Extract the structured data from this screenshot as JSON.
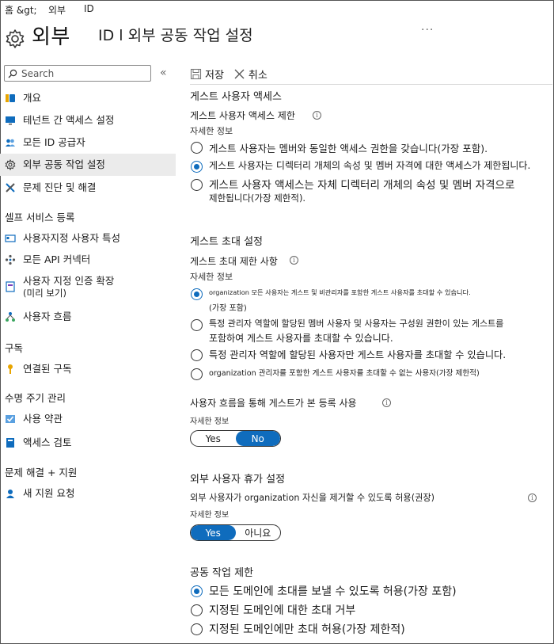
{
  "breadcrumb": [
    "홈 &gt;",
    "외부",
    "ID"
  ],
  "header": {
    "title": "외부",
    "subtitle": "ID l 외부 공동 작업 설정",
    "more": "···"
  },
  "sidebar": {
    "search_placeholder": "Search",
    "collapse": "«",
    "items": [
      {
        "label": "개요",
        "icon": "info-icon"
      },
      {
        "label": "테넌트 간 액세스 설정",
        "icon": "monitor-icon"
      },
      {
        "label": "모든 ID 공급자",
        "icon": "users-icon"
      },
      {
        "label": "외부 공동 작업 설정",
        "icon": "gear-icon"
      },
      {
        "label": "문제 진단 및 해결",
        "icon": "tools-icon"
      }
    ],
    "section_self_service": "셀프 서비스 등록",
    "self_service_items": [
      {
        "label": "사용자지정 사용자 특성",
        "icon": "card-icon"
      },
      {
        "label": "모든 API 커넥터",
        "icon": "connector-icon"
      },
      {
        "label": "사용자 지정 인증 확장",
        "label2": "(미리 보기)",
        "icon": "extension-icon"
      },
      {
        "label": "사용자 흐름",
        "icon": "flow-icon"
      }
    ],
    "section_subscription": "구독",
    "subscription_items": [
      {
        "label": "연결된 구독",
        "icon": "key-icon"
      }
    ],
    "section_lifecycle": "수명 주기 관리",
    "lifecycle_items": [
      {
        "label": "사용 약관",
        "icon": "checklist-icon"
      },
      {
        "label": "액세스 검토",
        "icon": "book-icon"
      }
    ],
    "section_support": "문제 해결 + 지원",
    "support_items": [
      {
        "label": "새 지원 요청",
        "icon": "support-icon"
      }
    ]
  },
  "toolbar": {
    "save": "저장",
    "cancel": "취소"
  },
  "guest_access": {
    "heading": "게스트 사용자 액세스",
    "subheading": "게스트 사용자 액세스 제한",
    "more_info": "자세한 정보",
    "options": [
      "게스트 사용자는 멤버와 동일한 액세스 권한을 갖습니다(가장 포함).",
      "게스트 사용자는 디렉터리 개체의 속성 및 멤버 자격에 대한 액세스가 제한됩니다.",
      "게스트 사용자 액세스는 자체 디렉터리 개체의 속성 및 멤버 자격으로",
      "제한됩니다(가장 제한적)."
    ],
    "selected": 1
  },
  "guest_invite": {
    "heading": "게스트 초대 설정",
    "subheading": "게스트 초대 제한 사항",
    "more_info": "자세한 정보",
    "options": [
      "organization 모든 사용자는 게스트 및 비관리자를 포함한 게스트 사용자를 초대할 수 있습니다.",
      "(가장 포함)",
      "특정 관리자 역할에 할당된 멤버 사용자 및 사용자는 구성원 권한이 있는 게스트를",
      "포함하여 게스트 사용자를 초대할 수 있습니다.",
      "특정 관리자 역할에 할당된 사용자만 게스트 사용자를 초대할 수 있습니다.",
      "organization 관리자를 포함한 게스트 사용자를 초대할 수 없는 사용자(가장 제한적)"
    ],
    "selected": 0
  },
  "self_service_signup": {
    "label": "사용자 흐름을 통해 게스트가 본 등록 사용",
    "more_info": "자세한 정보",
    "yes": "Yes",
    "no": "No",
    "selected": "No"
  },
  "leave_settings": {
    "heading": "외부 사용자 휴가 설정",
    "label": "외부 사용자가 organization 자신을 제거할 수 있도록 허용(권장)",
    "more_info": "자세한 정보",
    "yes": "Yes",
    "no": "아니요",
    "selected": "Yes"
  },
  "collab_restrictions": {
    "heading": "공동 작업 제한",
    "options": [
      "모든 도메인에 초대를 보낼 수 있도록 허용(가장 포함)",
      "지정된 도메인에 대한 초대 거부",
      "지정된 도메인에만 초대 허용(가장 제한적)"
    ],
    "selected": 0
  },
  "colors": {
    "accent": "#0f6cbd",
    "active_bg": "#ebebeb"
  }
}
